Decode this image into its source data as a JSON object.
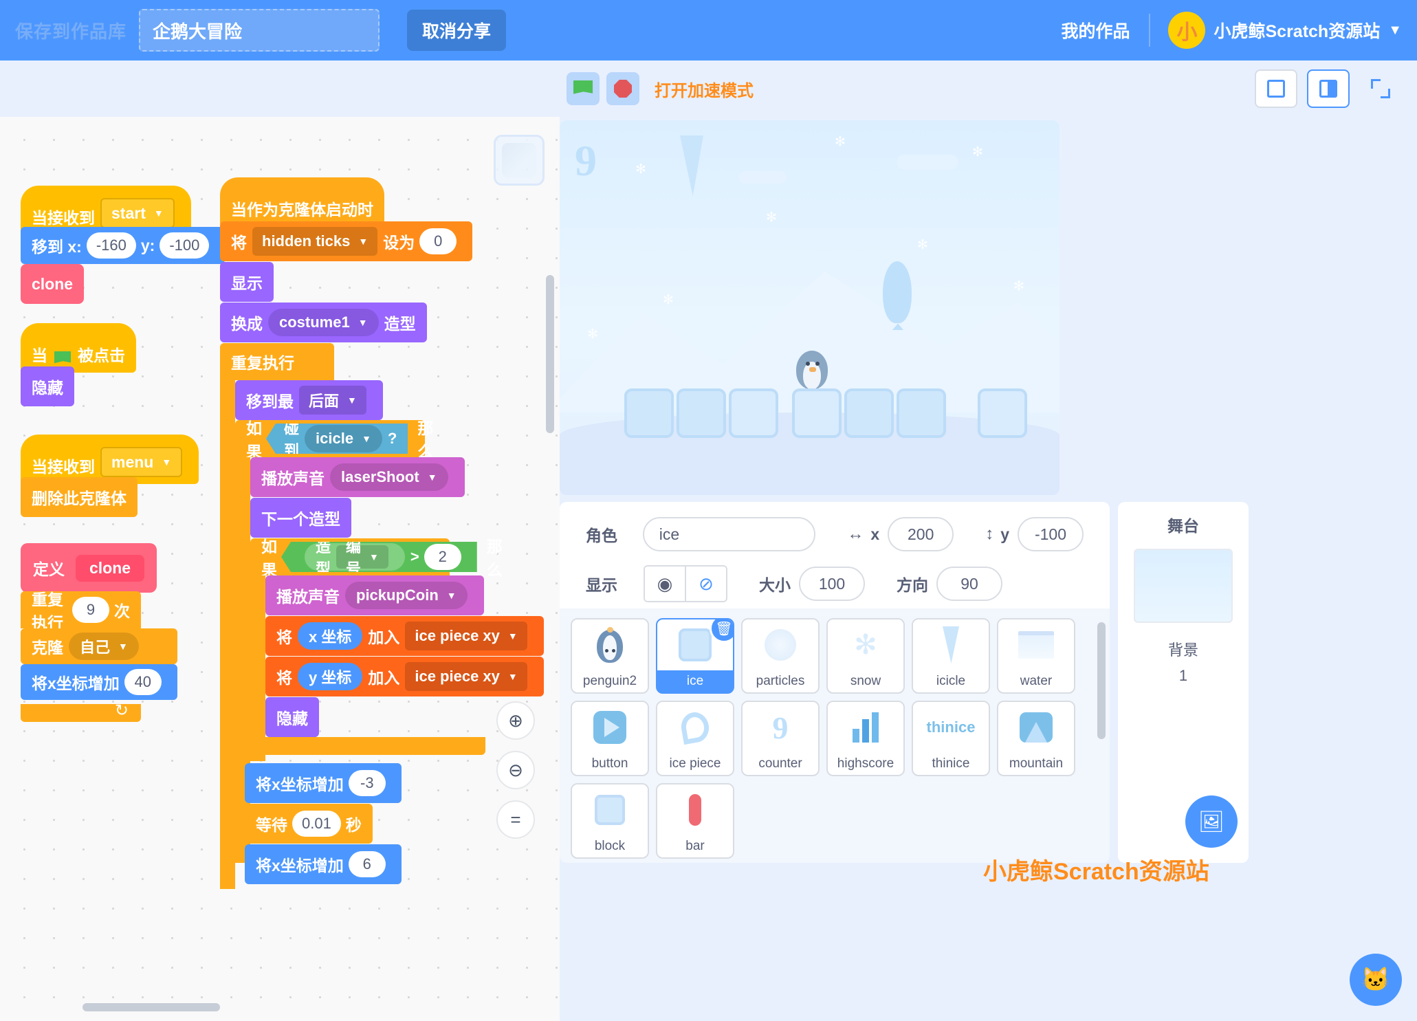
{
  "menubar": {
    "save_label": "保存到作品库",
    "project_title": "企鹅大冒险",
    "unshare_label": "取消分享",
    "my_works_label": "我的作品",
    "avatar_glyph": "小",
    "username": "小虎鲸Scratch资源站",
    "caret": "▼"
  },
  "toolbar": {
    "green_flag_icon": "green-flag-icon",
    "stop_icon": "stop-icon",
    "turbo_label": "打开加速模式",
    "small_stage_icon": "small-stage-icon",
    "large_stage_icon": "large-stage-icon",
    "fullscreen_icon": "fullscreen-icon"
  },
  "code": {
    "scripts": [
      {
        "id": "script-when-receive-start",
        "blocks": [
          {
            "type": "hat",
            "label": "当接收到",
            "dropdown": "start"
          },
          {
            "type": "motion",
            "label": "移到 x:",
            "v1": "-160",
            "label2": "y:",
            "v2": "-100"
          },
          {
            "type": "custom",
            "label": "clone"
          }
        ]
      },
      {
        "id": "script-when-flag-clicked",
        "blocks": [
          {
            "type": "hat",
            "label_a": "当",
            "label_b": "被点击"
          },
          {
            "type": "looks",
            "label": "隐藏"
          }
        ]
      },
      {
        "id": "script-when-receive-menu",
        "blocks": [
          {
            "type": "hat",
            "label": "当接收到",
            "dropdown": "menu"
          },
          {
            "type": "control",
            "label": "删除此克隆体"
          }
        ]
      },
      {
        "id": "script-define-clone",
        "blocks": [
          {
            "type": "define",
            "label": "定义",
            "proc": "clone"
          },
          {
            "type": "control",
            "label": "重复执行",
            "times": "9",
            "suffix": "次"
          },
          {
            "type": "control",
            "label": "克隆",
            "dropdown": "自己"
          },
          {
            "type": "motion",
            "label": "将x坐标增加",
            "value": "40"
          }
        ]
      },
      {
        "id": "script-when-clone-start",
        "blocks": [
          {
            "type": "hat",
            "label": "当作为克隆体启动时"
          },
          {
            "type": "vars",
            "label": "将",
            "dropdown": "hidden ticks",
            "label2": "设为",
            "value": "0"
          },
          {
            "type": "looks",
            "label": "显示"
          },
          {
            "type": "looks",
            "label": "换成",
            "dropdown": "costume1",
            "suffix": "造型"
          },
          {
            "type": "control",
            "label": "重复执行"
          },
          {
            "type": "looks",
            "label": "移到最",
            "dropdown": "后面"
          },
          {
            "type": "control",
            "label": "如果",
            "cond_label": "碰到",
            "cond_dropdown": "icicle",
            "cond_q": "?",
            "suffix": "那么"
          },
          {
            "type": "sound",
            "label": "播放声音",
            "dropdown": "laserShoot"
          },
          {
            "type": "looks",
            "label": "下一个造型"
          },
          {
            "type": "control",
            "label": "如果",
            "cond_a": "造型",
            "cond_dd": "编号",
            "op": ">",
            "cond_b": "2",
            "suffix": "那么"
          },
          {
            "type": "sound",
            "label": "播放声音",
            "dropdown": "pickupCoin"
          },
          {
            "type": "list",
            "label": "将",
            "item": "x 坐标",
            "label2": "加入",
            "dropdown": "ice piece xy"
          },
          {
            "type": "list",
            "label": "将",
            "item": "y 坐标",
            "label2": "加入",
            "dropdown": "ice piece xy"
          },
          {
            "type": "looks",
            "label": "隐藏"
          },
          {
            "type": "motion",
            "label": "将x坐标增加",
            "value": "-3"
          },
          {
            "type": "control",
            "label": "等待",
            "value": "0.01",
            "suffix": "秒"
          },
          {
            "type": "motion",
            "label": "将x坐标增加",
            "value": "6"
          }
        ]
      }
    ],
    "zoom_in_icon": "zoom-in-icon",
    "zoom_out_icon": "zoom-out-icon",
    "zoom_reset_icon": "zoom-reset-icon",
    "zoom_reset_label": "="
  },
  "stage": {
    "counter_value": "9"
  },
  "sprite_info": {
    "name_label": "角色",
    "name_value": "ice",
    "x_label": "x",
    "x_value": "200",
    "y_label": "y",
    "y_value": "-100",
    "show_label": "显示",
    "show_icon": "eye-icon",
    "hide_icon": "eye-slash-icon",
    "size_label": "大小",
    "size_value": "100",
    "direction_label": "方向",
    "direction_value": "90"
  },
  "sprite_list": {
    "sprites": [
      {
        "name": "penguin2",
        "icon": "penguin-icon",
        "selected": false
      },
      {
        "name": "ice",
        "icon": "ice-cube-icon",
        "selected": true
      },
      {
        "name": "particles",
        "icon": "particles-icon",
        "selected": false
      },
      {
        "name": "snow",
        "icon": "snowflake-icon",
        "selected": false
      },
      {
        "name": "icicle",
        "icon": "icicle-icon",
        "selected": false
      },
      {
        "name": "water",
        "icon": "water-icon",
        "selected": false
      },
      {
        "name": "button",
        "icon": "play-button-icon",
        "selected": false
      },
      {
        "name": "ice piece",
        "icon": "ice-piece-icon",
        "selected": false
      },
      {
        "name": "counter",
        "icon": "counter-icon",
        "selected": false
      },
      {
        "name": "highscore",
        "icon": "bar-chart-icon",
        "selected": false
      },
      {
        "name": "thinice",
        "icon": "thinice-icon",
        "selected": false
      },
      {
        "name": "mountain",
        "icon": "mountain-icon",
        "selected": false
      },
      {
        "name": "block",
        "icon": "block-icon",
        "selected": false
      },
      {
        "name": "bar",
        "icon": "bar-icon",
        "selected": false
      }
    ],
    "delete_icon": "trash-icon",
    "add_sprite_icon": "add-sprite-icon"
  },
  "stage_panel": {
    "title": "舞台",
    "backdrop_label": "背景",
    "backdrop_count": "1",
    "add_backdrop_icon": "add-backdrop-icon"
  },
  "watermark": {
    "text": "小虎鲸Scratch资源站"
  },
  "colors": {
    "brand_blue": "#4c97ff",
    "events": "#ffbf00",
    "motion": "#4c97ff",
    "looks": "#9966ff",
    "sound": "#cf63cf",
    "control": "#ffab19",
    "sensing": "#5cb1d6",
    "operators": "#59c059",
    "variables": "#ff8c1a",
    "lists": "#ff661a",
    "custom": "#ff6680",
    "accent_orange": "#ff8c1a"
  }
}
